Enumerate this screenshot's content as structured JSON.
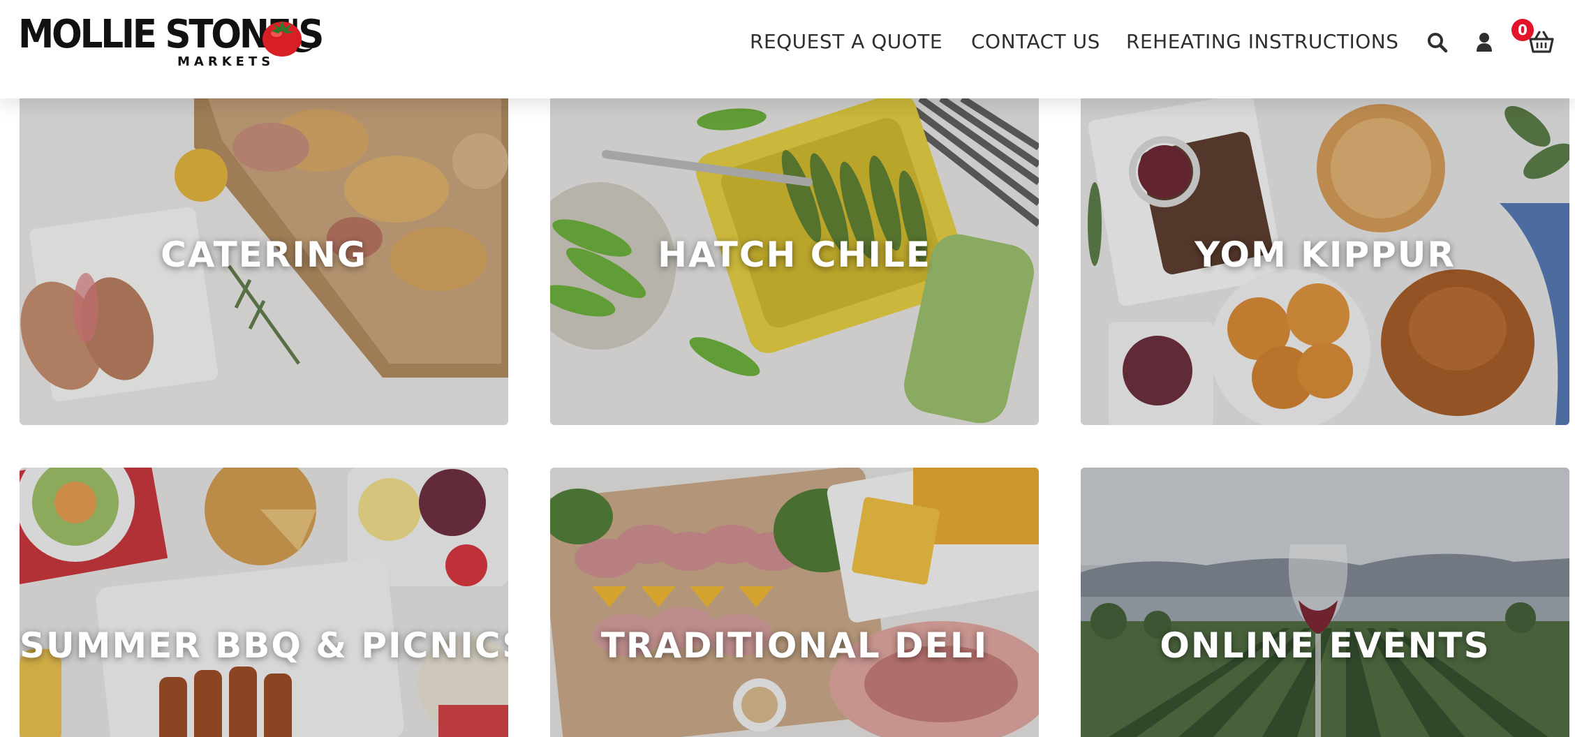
{
  "brand": {
    "name": "MOLLIE STONE'S",
    "subtitle": "MARKETS"
  },
  "nav": {
    "links": [
      "REQUEST A QUOTE",
      "CONTACT US",
      "REHEATING INSTRUCTIONS"
    ],
    "icons": [
      "search-icon",
      "user-icon",
      "cart-icon"
    ],
    "cart_count": "0"
  },
  "tiles": [
    {
      "label": "CATERING"
    },
    {
      "label": "HATCH CHILE"
    },
    {
      "label": "YOM KIPPUR"
    },
    {
      "label": "SUMMER BBQ & PICNICS"
    },
    {
      "label": "TRADITIONAL DELI"
    },
    {
      "label": "ONLINE EVENTS"
    }
  ],
  "colors": {
    "accent_red": "#e3132a",
    "nav_text": "#2f2f2f",
    "logo_text": "#111111"
  }
}
